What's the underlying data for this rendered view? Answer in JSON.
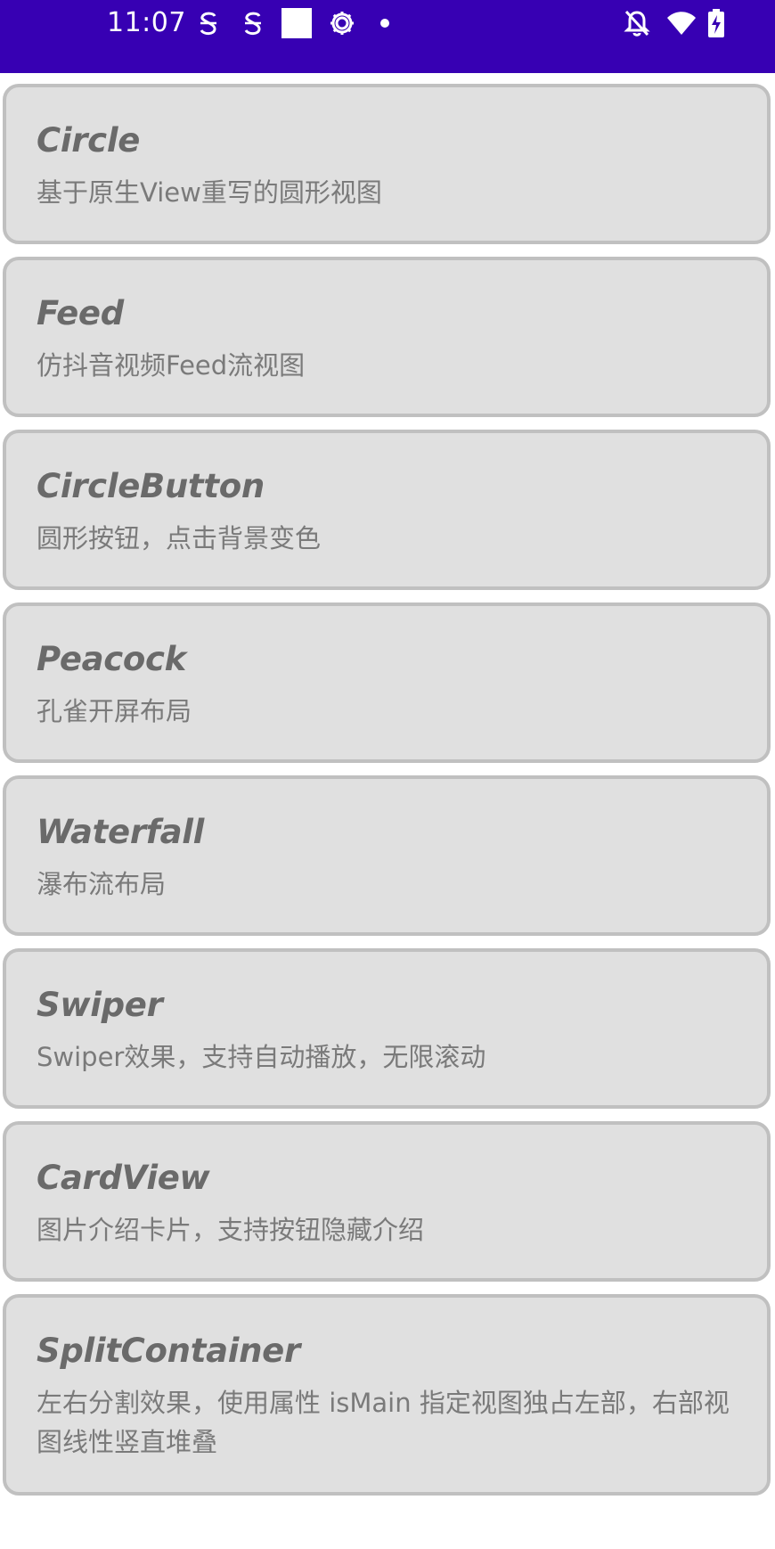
{
  "status_bar": {
    "time": "11:07",
    "background_color": "#3700b3",
    "icons_left": [
      "sim-s-icon",
      "sim-s-icon",
      "white-square-icon",
      "gear-icon",
      "dot-icon"
    ],
    "icons_right": [
      "bell-off-icon",
      "wifi-icon",
      "battery-charging-icon"
    ]
  },
  "list": {
    "items": [
      {
        "title": "Circle",
        "description": "基于原生View重写的圆形视图"
      },
      {
        "title": "Feed",
        "description": "仿抖音视频Feed流视图"
      },
      {
        "title": "CircleButton",
        "description": "圆形按钮，点击背景变色"
      },
      {
        "title": "Peacock",
        "description": "孔雀开屏布局"
      },
      {
        "title": "Waterfall",
        "description": "瀑布流布局"
      },
      {
        "title": "Swiper",
        "description": "Swiper效果，支持自动播放，无限滚动"
      },
      {
        "title": "CardView",
        "description": "图片介绍卡片，支持按钮隐藏介绍"
      },
      {
        "title": "SplitContainer",
        "description": "左右分割效果，使用属性 isMain 指定视图独占左部，右部视图线性竖直堆叠"
      }
    ]
  },
  "colors": {
    "card_background": "#e0e0e0",
    "card_border": "#c0c0c0",
    "title_text": "#6a6a6a",
    "description_text": "#7a7a7a"
  }
}
